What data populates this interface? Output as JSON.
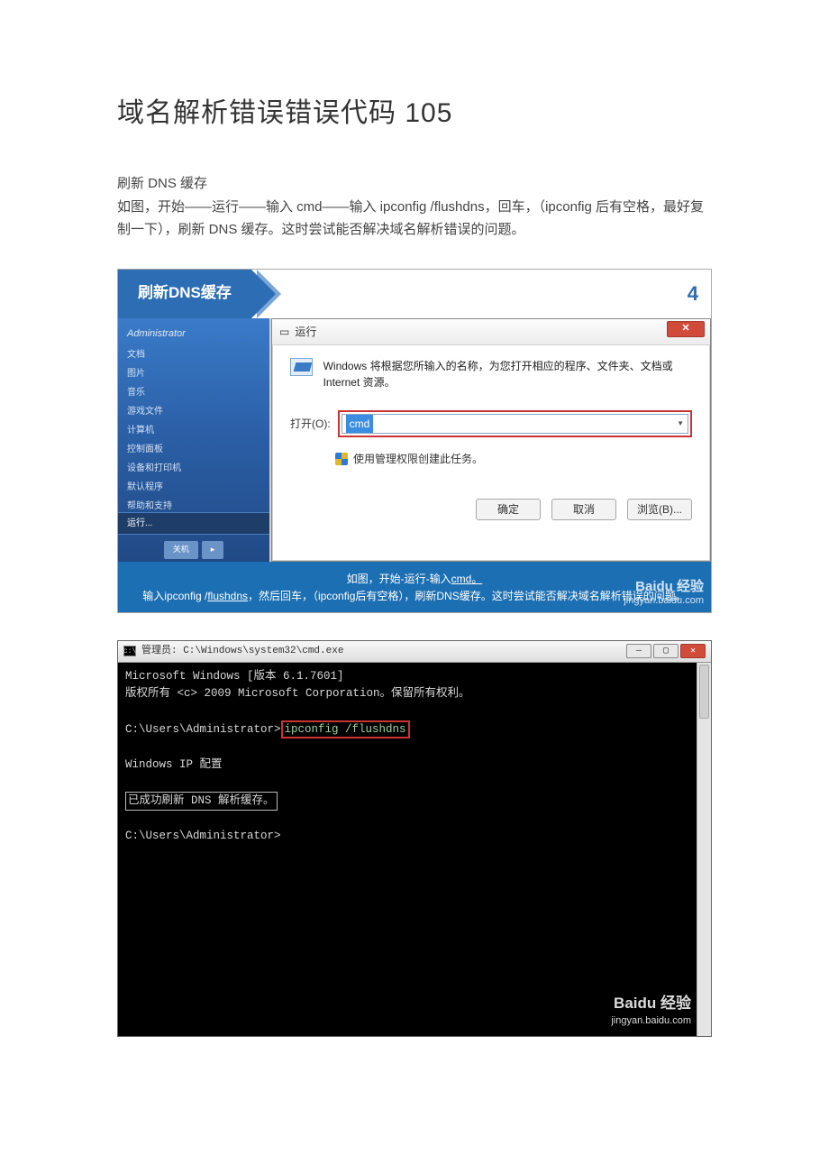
{
  "title": "域名解析错误错误代码 105",
  "section": "刷新 DNS 缓存",
  "intro": "如图，开始——运行——输入 cmd——输入 ipconfig  /flushdns，回车，（ipconfig 后有空格，最好复制一下），刷新 DNS 缓存。这时尝试能否解决域名解析错误的问题。",
  "step": {
    "label": "刷新DNS缓存",
    "num": "4"
  },
  "startmenu": {
    "admin": "Administrator",
    "items": [
      "文档",
      "图片",
      "音乐",
      "游戏文件",
      "计算机",
      "控制面板",
      "设备和打印机",
      "默认程序",
      "帮助和支持"
    ],
    "run": "运行...",
    "shutdown": "关机"
  },
  "run": {
    "title": "运行",
    "desc": "Windows 将根据您所输入的名称，为您打开相应的程序、文件夹、文档或 Internet 资源。",
    "open_label": "打开(O):",
    "value": "cmd",
    "admin_note": "使用管理权限创建此任务。",
    "ok": "确定",
    "cancel": "取消",
    "browse": "浏览(B)..."
  },
  "caption": {
    "line1_a": "如图，开始-运行-输入",
    "line1_b": "cmd。",
    "line2_a": "输入ipconfig /",
    "line2_b": "flushdns",
    "line2_c": "，然后回车，（ipconfig后有空格），刷新DNS缓存。这时尝试能否解决域名解析错误的问题。"
  },
  "watermark": {
    "brand": "Baidu 经验",
    "url": "jingyan.baidu.com"
  },
  "cmd": {
    "title": "管理员: C:\\Windows\\system32\\cmd.exe",
    "l1": "Microsoft Windows [版本 6.1.7601]",
    "l2": "版权所有 <c> 2009 Microsoft Corporation。保留所有权利。",
    "prompt1_a": "C:\\Users\\Administrator>",
    "prompt1_b": "ipconfig /flushdns",
    "l4": "Windows IP 配置",
    "l5": "已成功刷新 DNS 解析缓存。",
    "prompt2": "C:\\Users\\Administrator>"
  }
}
